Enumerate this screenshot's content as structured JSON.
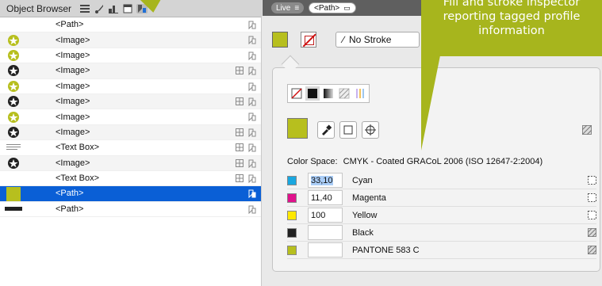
{
  "object_browser": {
    "title": "Object Browser",
    "tools": [
      "list-icon",
      "brush-icon",
      "chart-icon",
      "page-icon",
      "tag-profile-icon"
    ],
    "rows": [
      {
        "name": "<Path>",
        "thumb": "white-box",
        "grid": false,
        "selected": false
      },
      {
        "name": "<Image>",
        "thumb": "green-badge",
        "grid": false,
        "selected": false
      },
      {
        "name": "<Image>",
        "thumb": "green-badge",
        "grid": false,
        "selected": false
      },
      {
        "name": "<Image>",
        "thumb": "black-badge",
        "grid": true,
        "selected": false
      },
      {
        "name": "<Image>",
        "thumb": "green-badge",
        "grid": false,
        "selected": false
      },
      {
        "name": "<Image>",
        "thumb": "black-badge",
        "grid": true,
        "selected": false
      },
      {
        "name": "<Image>",
        "thumb": "green-badge",
        "grid": false,
        "selected": false
      },
      {
        "name": "<Image>",
        "thumb": "black-badge",
        "grid": true,
        "selected": false
      },
      {
        "name": "<Text Box>",
        "thumb": "text-lines",
        "grid": true,
        "selected": false
      },
      {
        "name": "<Image>",
        "thumb": "black-badge",
        "grid": true,
        "selected": false
      },
      {
        "name": "<Text Box>",
        "thumb": "white-box",
        "grid": true,
        "selected": false
      },
      {
        "name": "<Path>",
        "thumb": "green-swatch",
        "grid": false,
        "selected": true
      },
      {
        "name": "<Path>",
        "thumb": "black-bar",
        "grid": false,
        "selected": false
      }
    ]
  },
  "breadcrumb": {
    "live_label": "Live",
    "path_label": "<Path>"
  },
  "toolbar": {
    "stroke_label": "No Stroke"
  },
  "inspector": {
    "color_space_prefix": "Color Space:",
    "color_space_value": "CMYK - Coated GRACoL 2006 (ISO 12647-2:2004)",
    "fill_color": "#b7bf1e",
    "channels": [
      {
        "value": "33,10",
        "name": "Cyan",
        "color": "#1aa7e0",
        "icon": "dotted-square-icon",
        "highlight": true
      },
      {
        "value": "11,40",
        "name": "Magenta",
        "color": "#e0128c",
        "icon": "dotted-square-icon",
        "highlight": false
      },
      {
        "value": "100",
        "name": "Yellow",
        "color": "#ffe800",
        "icon": "dotted-square-icon",
        "highlight": false
      },
      {
        "value": "",
        "name": "Black",
        "color": "#222222",
        "icon": "hatch-icon",
        "highlight": false
      },
      {
        "value": "",
        "name": "PANTONE 583 C",
        "color": "#b7bf1e",
        "icon": "hatch-icon",
        "highlight": false
      }
    ]
  },
  "callout": {
    "lines": [
      "Fill and stroke inspector",
      "reporting tagged profile",
      "information"
    ]
  }
}
